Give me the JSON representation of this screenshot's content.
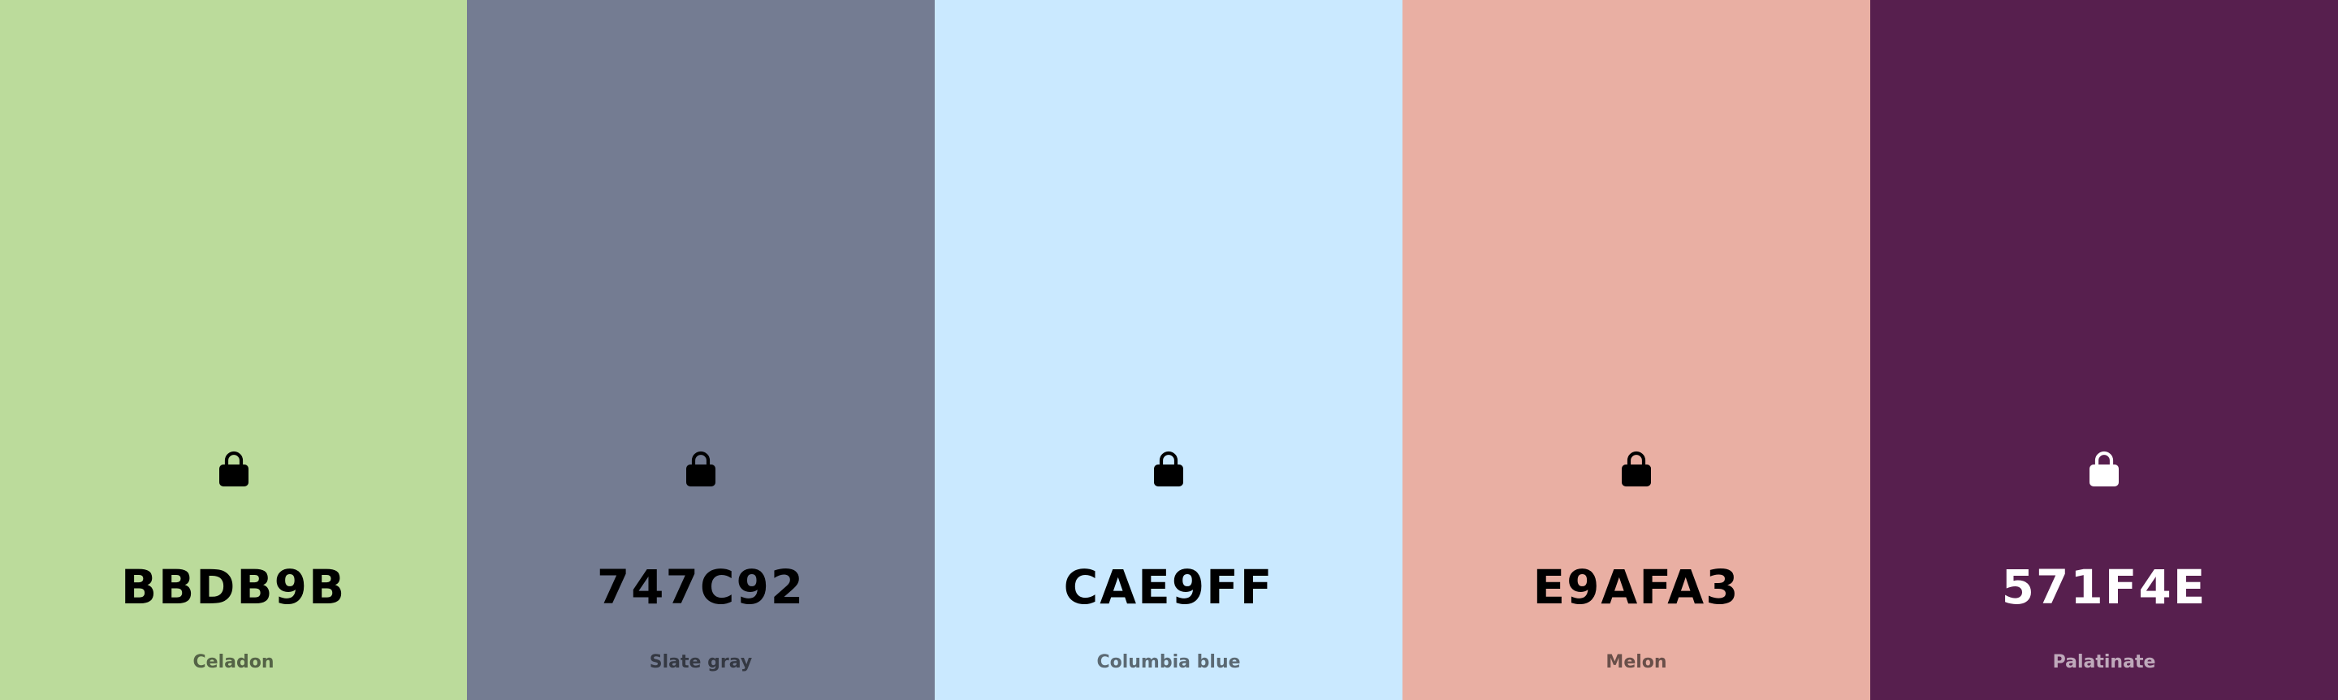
{
  "palette": {
    "colors": [
      {
        "hex": "BBDB9B",
        "name": "Celadon",
        "color": "#BBDB9B",
        "text_color": "#000000",
        "icon": "lock-icon"
      },
      {
        "hex": "747C92",
        "name": "Slate gray",
        "color": "#747C92",
        "text_color": "#000000",
        "icon": "lock-icon"
      },
      {
        "hex": "CAE9FF",
        "name": "Columbia blue",
        "color": "#CAE9FF",
        "text_color": "#000000",
        "icon": "lock-icon"
      },
      {
        "hex": "E9AFA3",
        "name": "Melon",
        "color": "#E9AFA3",
        "text_color": "#000000",
        "icon": "lock-icon"
      },
      {
        "hex": "571F4E",
        "name": "Palatinate",
        "color": "#571F4E",
        "text_color": "#FFFFFF",
        "icon": "lock-icon"
      }
    ]
  }
}
